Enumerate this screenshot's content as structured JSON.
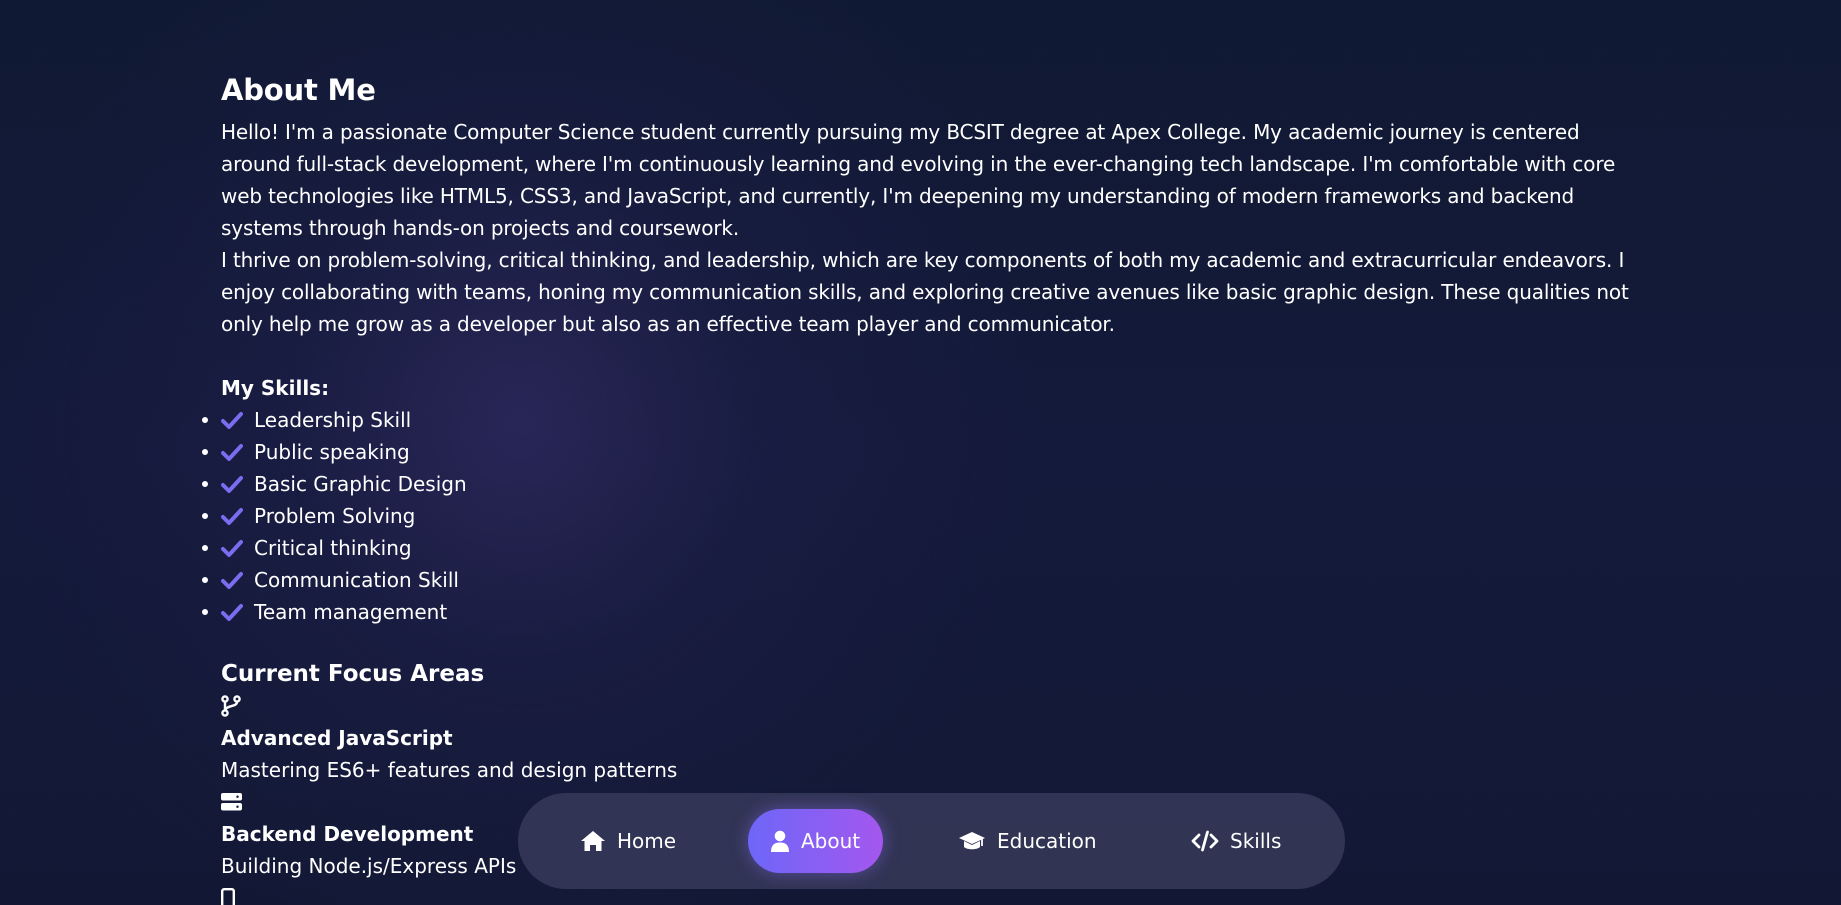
{
  "about": {
    "title": "About Me",
    "paragraph1": "Hello! I'm a passionate Computer Science student currently pursuing my BCSIT degree at Apex College. My academic journey is centered around full-stack development, where I'm continuously learning and evolving in the ever-changing tech landscape. I'm comfortable with core web technologies like HTML5, CSS3, and JavaScript, and currently, I'm deepening my understanding of modern frameworks and backend systems through hands-on projects and coursework.",
    "paragraph2": "I thrive on problem-solving, critical thinking, and leadership, which are key components of both my academic and extracurricular endeavors. I enjoy collaborating with teams, honing my communication skills, and exploring creative avenues like basic graphic design. These qualities not only help me grow as a developer but also as an effective team player and communicator."
  },
  "skills": {
    "heading": "My Skills:",
    "items": [
      {
        "label": "Leadership Skill",
        "icon": "check-icon"
      },
      {
        "label": "Public speaking",
        "icon": "check-icon"
      },
      {
        "label": "Basic Graphic Design",
        "icon": "check-icon"
      },
      {
        "label": "Problem Solving",
        "icon": "check-icon"
      },
      {
        "label": "Critical thinking",
        "icon": "check-icon"
      },
      {
        "label": "Communication Skill",
        "icon": "check-icon"
      },
      {
        "label": "Team management",
        "icon": "check-icon"
      }
    ],
    "check_color": "#7b6cf0"
  },
  "focus": {
    "heading": "Current Focus Areas",
    "items": [
      {
        "icon": "code-branch-icon",
        "name": "Advanced JavaScript",
        "desc": "Mastering ES6+ features and design patterns"
      },
      {
        "icon": "server-icon",
        "name": "Backend Development",
        "desc": "Building Node.js/Express APIs"
      }
    ]
  },
  "nav": {
    "items": [
      {
        "label": "Home",
        "icon": "home-icon",
        "active": false
      },
      {
        "label": "About",
        "icon": "user-icon",
        "active": true
      },
      {
        "label": "Education",
        "icon": "graduation-cap-icon",
        "active": false
      },
      {
        "label": "Skills",
        "icon": "code-icon",
        "active": false
      }
    ],
    "active_gradient": [
      "#6d67f8",
      "#a457ee"
    ]
  }
}
